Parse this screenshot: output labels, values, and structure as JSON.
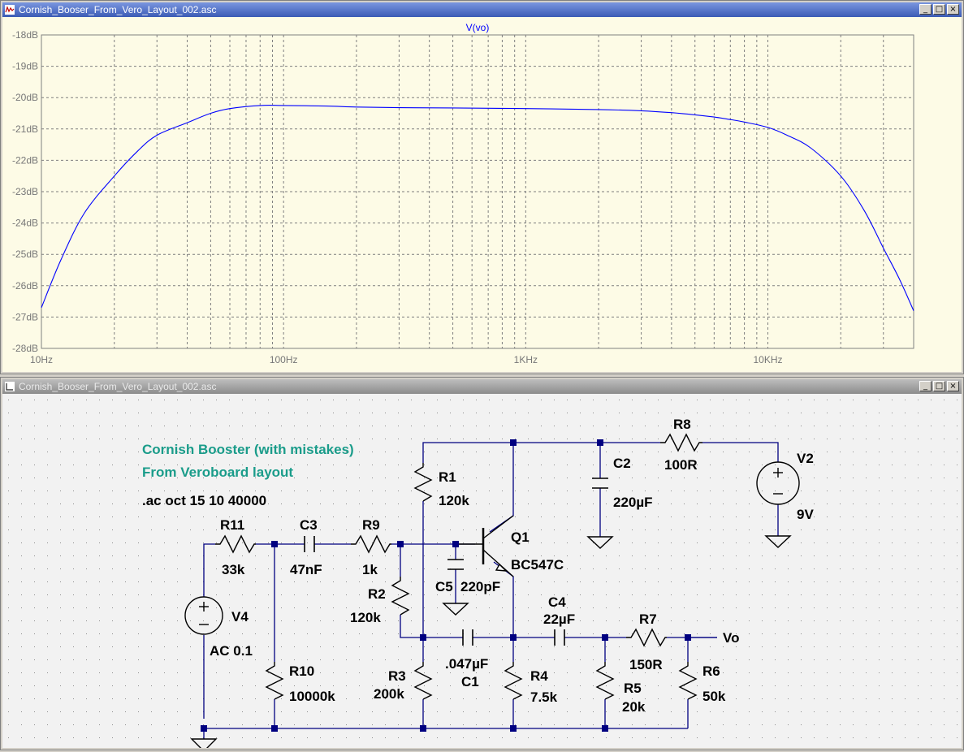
{
  "plot_window": {
    "title": "Cornish_Booser_From_Vero_Layout_002.asc",
    "buttons": {
      "minimize": "_",
      "maximize": "□",
      "close": "×"
    }
  },
  "schematic_window": {
    "title": "Cornish_Booser_From_Vero_Layout_002.asc",
    "buttons": {
      "minimize": "_",
      "maximize": "□",
      "close": "×"
    }
  },
  "chart_data": {
    "type": "line",
    "title": "V(vo)",
    "x_scale": "log",
    "xlim": [
      10,
      40000
    ],
    "ylim": [
      -28,
      -18
    ],
    "x_ticks": [
      {
        "value": 10,
        "label": "10Hz"
      },
      {
        "value": 100,
        "label": "100Hz"
      },
      {
        "value": 1000,
        "label": "1KHz"
      },
      {
        "value": 10000,
        "label": "10KHz"
      }
    ],
    "y_ticks": [
      {
        "value": -18,
        "label": "-18dB"
      },
      {
        "value": -19,
        "label": "-19dB"
      },
      {
        "value": -20,
        "label": "-20dB"
      },
      {
        "value": -21,
        "label": "-21dB"
      },
      {
        "value": -22,
        "label": "-22dB"
      },
      {
        "value": -23,
        "label": "-23dB"
      },
      {
        "value": -24,
        "label": "-24dB"
      },
      {
        "value": -25,
        "label": "-25dB"
      },
      {
        "value": -26,
        "label": "-26dB"
      },
      {
        "value": -27,
        "label": "-27dB"
      },
      {
        "value": -28,
        "label": "-28dB"
      }
    ],
    "grid": true,
    "line_color": "#0000ff",
    "series": [
      {
        "name": "V(vo)",
        "x": [
          10,
          12,
          15,
          20,
          25,
          30,
          40,
          50,
          60,
          80,
          100,
          150,
          200,
          300,
          500,
          1000,
          2000,
          3000,
          4000,
          5000,
          6000,
          7000,
          8000,
          10000,
          12000,
          15000,
          20000,
          25000,
          30000,
          35000,
          40000
        ],
        "y": [
          -26.7,
          -25.2,
          -23.7,
          -22.5,
          -21.7,
          -21.2,
          -20.8,
          -20.5,
          -20.35,
          -20.25,
          -20.25,
          -20.27,
          -20.3,
          -20.32,
          -20.33,
          -20.35,
          -20.38,
          -20.42,
          -20.48,
          -20.55,
          -20.62,
          -20.7,
          -20.78,
          -20.95,
          -21.2,
          -21.6,
          -22.5,
          -23.6,
          -24.8,
          -25.8,
          -26.8
        ]
      }
    ]
  },
  "schematic": {
    "notes": [
      "Cornish Booster (with mistakes)",
      "From Veroboard layout"
    ],
    "directive": ".ac oct 15 10 40000",
    "net_label": "Vo",
    "components": {
      "R1": {
        "name": "R1",
        "value": "120k"
      },
      "R2": {
        "name": "R2",
        "value": "120k"
      },
      "R3": {
        "name": "R3",
        "value": "200k"
      },
      "R4": {
        "name": "R4",
        "value": "7.5k"
      },
      "R5": {
        "name": "R5",
        "value": "20k"
      },
      "R6": {
        "name": "R6",
        "value": "50k"
      },
      "R7": {
        "name": "R7",
        "value": "150R"
      },
      "R8": {
        "name": "R8",
        "value": "100R"
      },
      "R9": {
        "name": "R9",
        "value": "1k"
      },
      "R10": {
        "name": "R10",
        "value": "10000k"
      },
      "R11": {
        "name": "R11",
        "value": "33k"
      },
      "C1": {
        "name": "C1",
        "value": ".047µF"
      },
      "C2": {
        "name": "C2",
        "value": "220µF"
      },
      "C3": {
        "name": "C3",
        "value": "47nF"
      },
      "C4": {
        "name": "C4",
        "value": "22µF"
      },
      "C5": {
        "name": "C5",
        "value": "220pF"
      },
      "Q1": {
        "name": "Q1",
        "value": "BC547C"
      },
      "V2": {
        "name": "V2",
        "value": "9V"
      },
      "V4": {
        "name": "V4",
        "value": "AC 0.1"
      }
    },
    "colors": {
      "note_text": "#1a9c8a",
      "wire": "#000080",
      "component": "#000000",
      "background": "#f2f2f2"
    }
  }
}
